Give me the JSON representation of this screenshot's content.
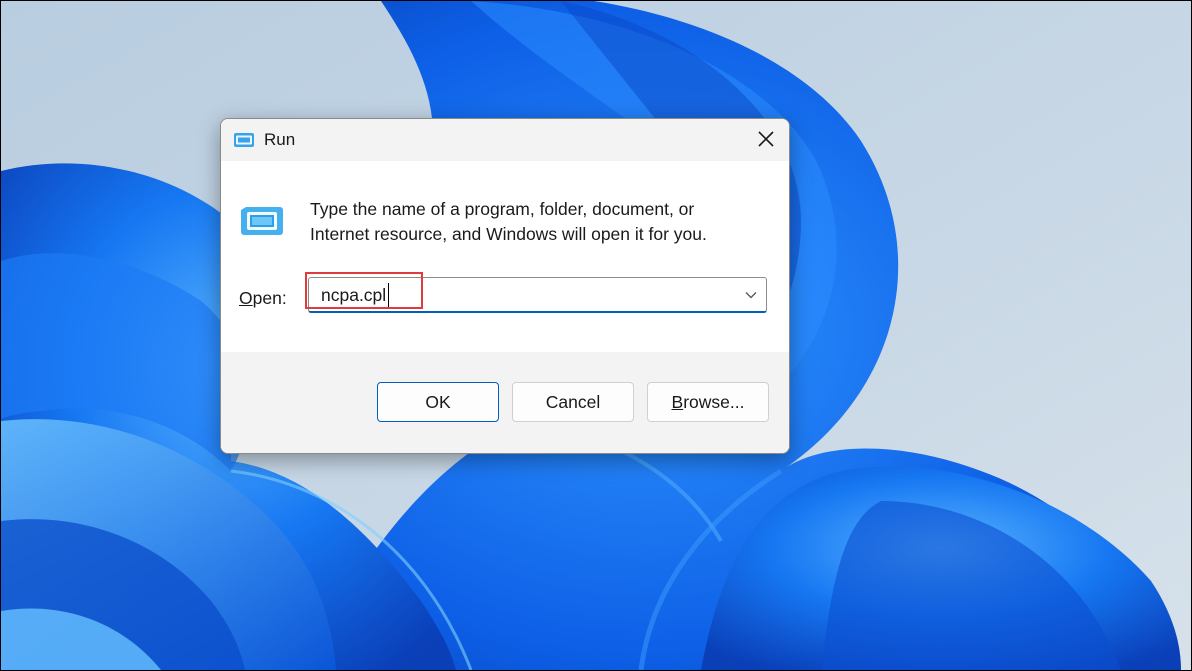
{
  "window": {
    "title": "Run",
    "icon": "run-icon",
    "close_icon": "close-icon"
  },
  "body": {
    "icon": "run-icon",
    "description_line1": "Type the name of a program, folder, document, or",
    "description_line2": "Internet resource, and Windows will open it for you."
  },
  "open_field": {
    "label_underlined": "O",
    "label_rest": "pen:",
    "value": "ncpa.cpl",
    "dropdown_icon": "chevron-down-icon"
  },
  "buttons": {
    "ok_label": "OK",
    "cancel_label": "Cancel",
    "browse_underlined": "B",
    "browse_rest": "rowse..."
  },
  "colors": {
    "accent": "#005fb8",
    "highlight": "#e23b3b",
    "wallpaper_blue": "#0a5ce0"
  }
}
